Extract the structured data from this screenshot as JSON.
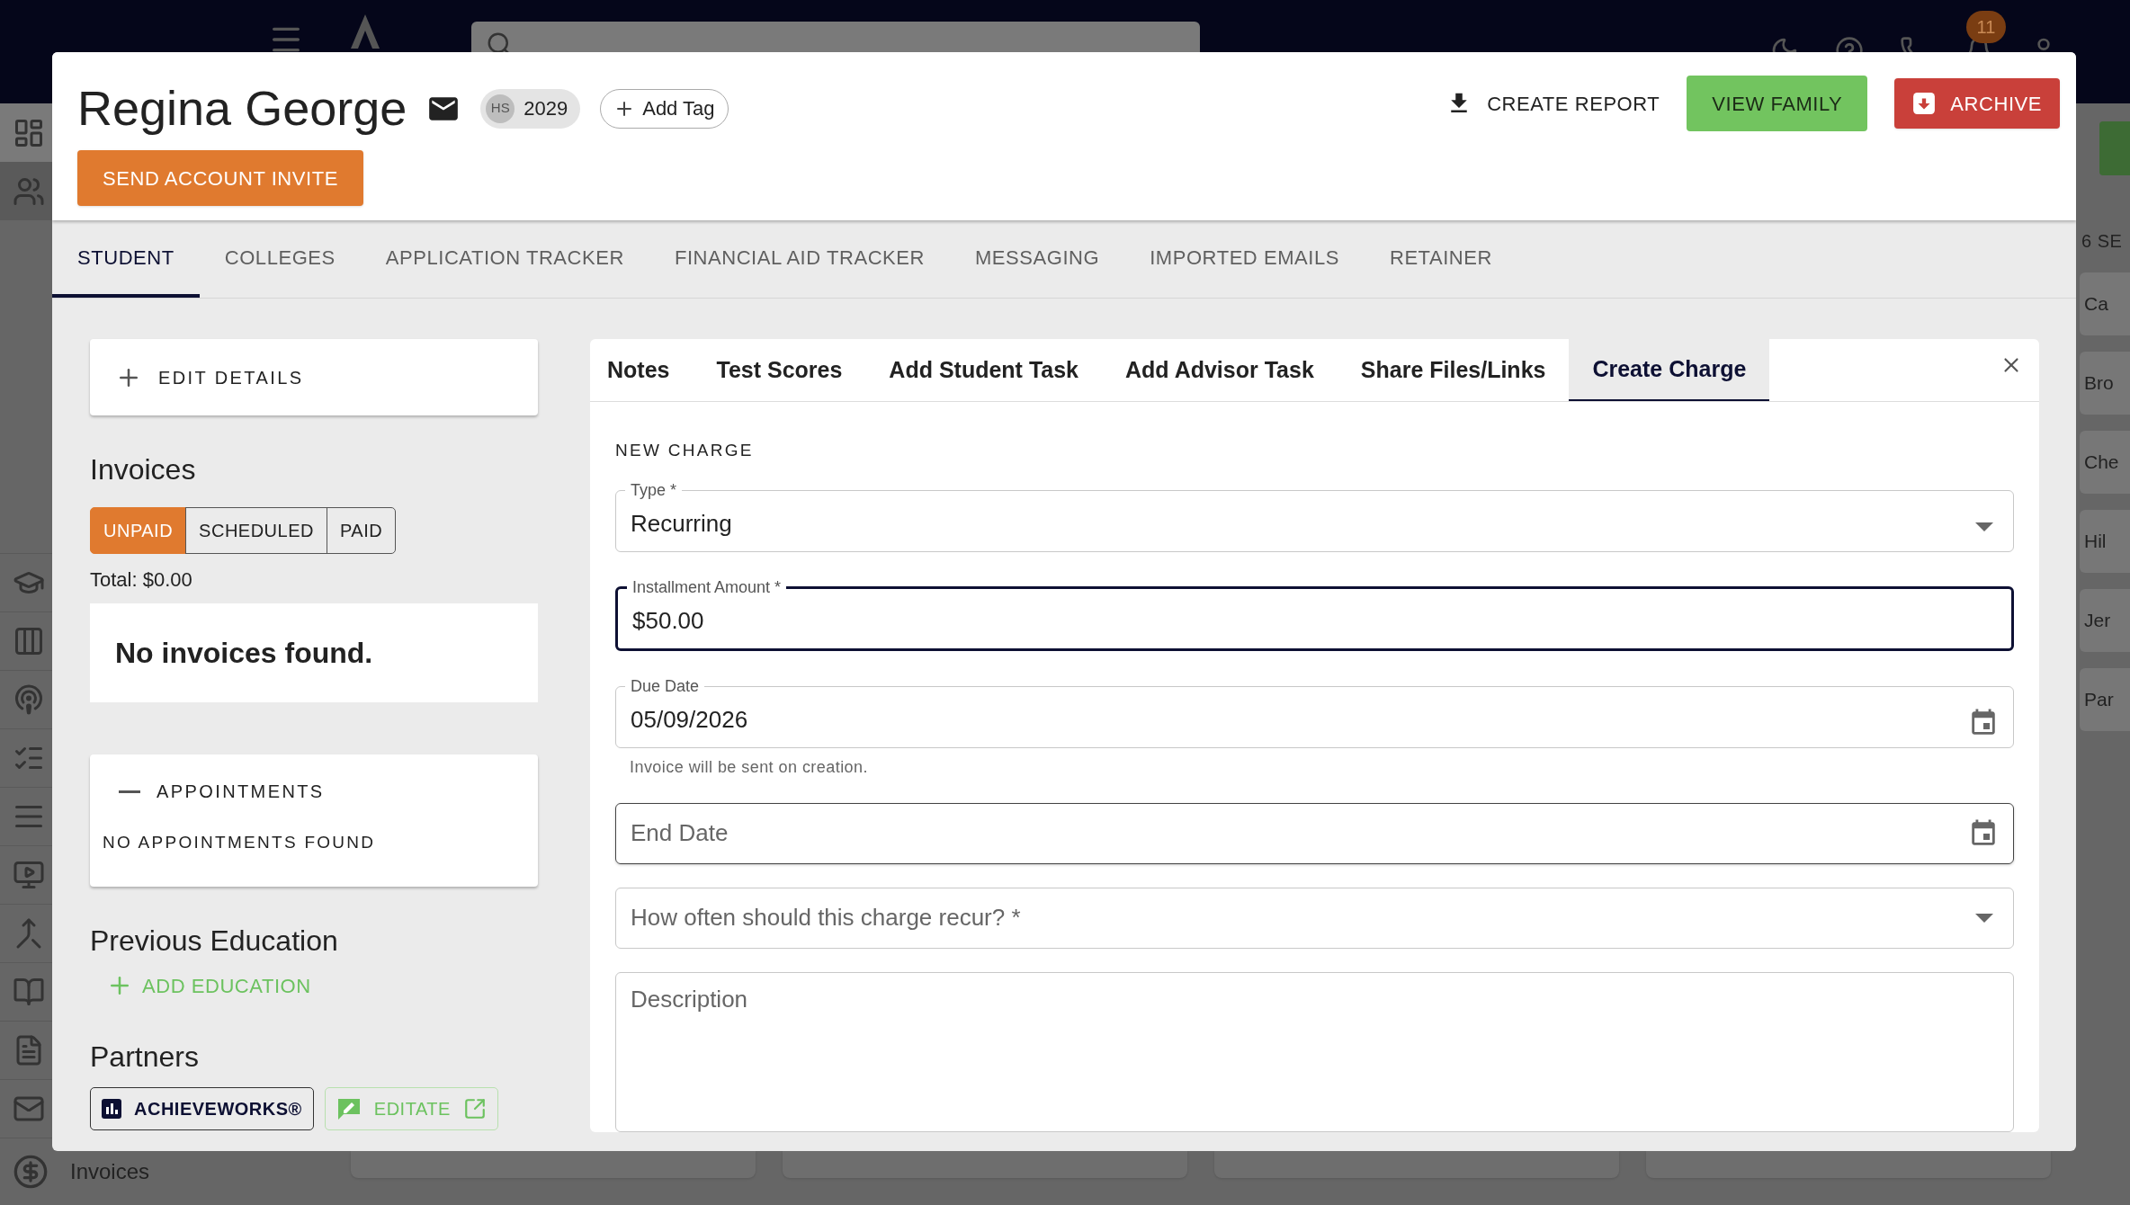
{
  "app_bar": {
    "notification_count": "11"
  },
  "background": {
    "sidebar_bottom_item": "Invoices",
    "right_header": "6 SE",
    "right_items": [
      "Ca",
      "Bro",
      "Che",
      "Hil",
      "Jer",
      "Par"
    ]
  },
  "student": {
    "name": "Regina George",
    "grade_chip": {
      "avatar": "HS",
      "label": "2029"
    },
    "add_tag": "Add Tag",
    "invite_button": "SEND ACCOUNT INVITE"
  },
  "header_actions": [
    {
      "kind": "text",
      "label": "CREATE REPORT"
    },
    {
      "kind": "success",
      "label": "VIEW FAMILY"
    },
    {
      "kind": "danger",
      "label": "ARCHIVE"
    }
  ],
  "tabs": [
    {
      "label": "STUDENT",
      "selected": true
    },
    {
      "label": "COLLEGES",
      "selected": false
    },
    {
      "label": "APPLICATION TRACKER",
      "selected": false
    },
    {
      "label": "FINANCIAL AID TRACKER",
      "selected": false
    },
    {
      "label": "MESSAGING",
      "selected": false
    },
    {
      "label": "IMPORTED EMAILS",
      "selected": false
    },
    {
      "label": "RETAINER",
      "selected": false
    }
  ],
  "edit_details": "EDIT DETAILS",
  "invoices": {
    "title": "Invoices",
    "filters": [
      {
        "label": "UNPAID",
        "selected": true
      },
      {
        "label": "SCHEDULED",
        "selected": false
      },
      {
        "label": "PAID",
        "selected": false
      }
    ],
    "total": "Total: $0.00",
    "empty": "No invoices found."
  },
  "appointments": {
    "title": "APPOINTMENTS",
    "expanded": true,
    "empty": "NO APPOINTMENTS FOUND"
  },
  "previous_education": {
    "title": "Previous Education",
    "add": "ADD EDUCATION"
  },
  "partners": {
    "title": "Partners",
    "links": [
      {
        "kind": "dark",
        "label": "ACHIEVEWORKS®"
      },
      {
        "kind": "green",
        "label": "EDITATE"
      }
    ]
  },
  "panel_tabs": [
    {
      "label": "Notes",
      "selected": false
    },
    {
      "label": "Test Scores",
      "selected": false
    },
    {
      "label": "Add Student Task",
      "selected": false
    },
    {
      "label": "Add Advisor Task",
      "selected": false
    },
    {
      "label": "Share Files/Links",
      "selected": false
    },
    {
      "label": "Create Charge",
      "selected": true
    }
  ],
  "form": {
    "section": "NEW CHARGE",
    "fields": [
      {
        "kind": "select",
        "label": "Type *",
        "value": "Recurring",
        "focused": false,
        "hovered": false
      },
      {
        "kind": "text",
        "label": "Installment Amount *",
        "value": "$50.00",
        "focused": true,
        "hovered": false
      },
      {
        "kind": "date",
        "label": "Due Date",
        "value": "05/09/2026",
        "helper": "Invoice will be sent on creation.",
        "focused": false,
        "hovered": false
      },
      {
        "kind": "date",
        "placeholder": "End Date",
        "focused": false,
        "hovered": true
      },
      {
        "kind": "select",
        "placeholder": "How often should this charge recur? *",
        "focused": false,
        "hovered": false
      },
      {
        "kind": "textarea",
        "placeholder": "Description",
        "focused": false,
        "hovered": false
      }
    ]
  }
}
